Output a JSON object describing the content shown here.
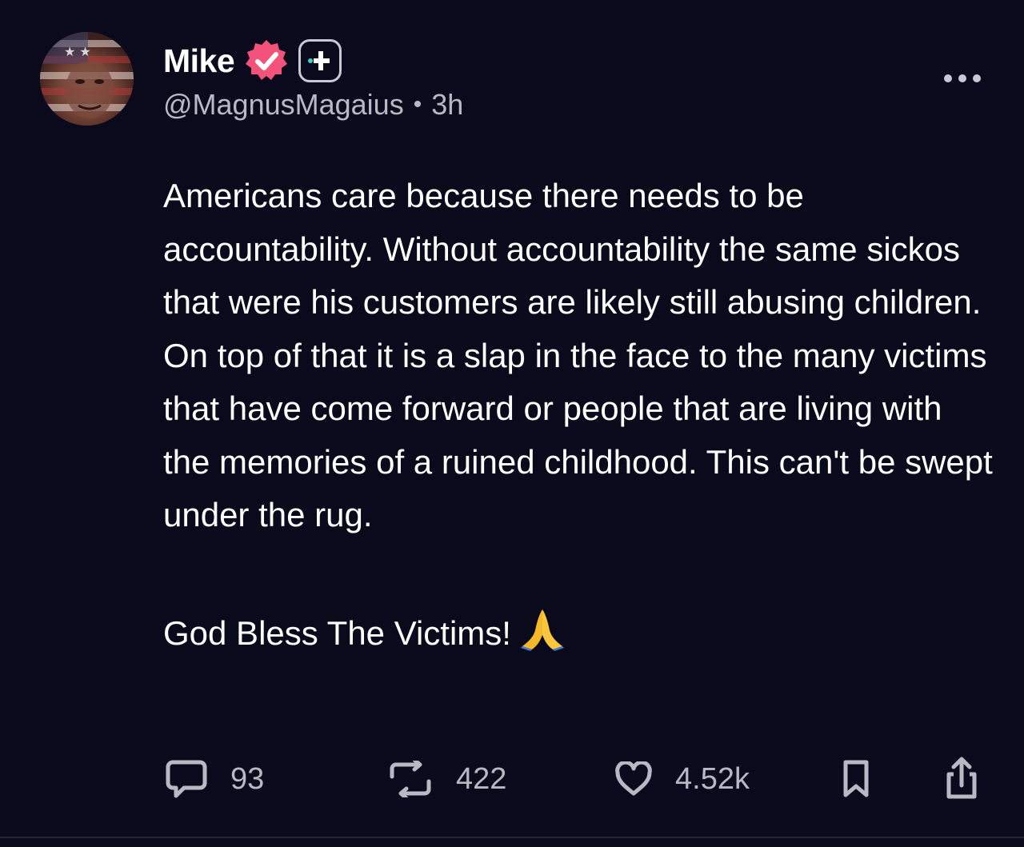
{
  "author": {
    "display_name": "Mike",
    "handle": "@MagnusMagaius",
    "separator": "•",
    "time": "3h",
    "verified_color": "#f3537a"
  },
  "post": {
    "paragraphs": [
      "Americans care because there needs to be accountability. Without accountability the same sickos that were his customers are likely still abusing children. On top of that it is a slap in the face to the many victims that have come forward or people that are living with the memories of a ruined childhood. This can't be swept under the rug.",
      "God Bless The Victims!"
    ],
    "emoji": "folded-hands"
  },
  "actions": {
    "replies": "93",
    "reposts": "422",
    "likes": "4.52k"
  },
  "icons": {
    "reply": "speech-bubble-icon",
    "repost": "repost-arrows-icon",
    "like": "heart-icon",
    "bookmark": "bookmark-icon",
    "share": "share-icon",
    "more": "more-dots-icon",
    "verified": "verified-badge-icon",
    "plus": "plus-badge-icon"
  },
  "colors": {
    "background": "#0b0a1c",
    "text": "#ffffff",
    "muted": "#b9b9c6"
  }
}
